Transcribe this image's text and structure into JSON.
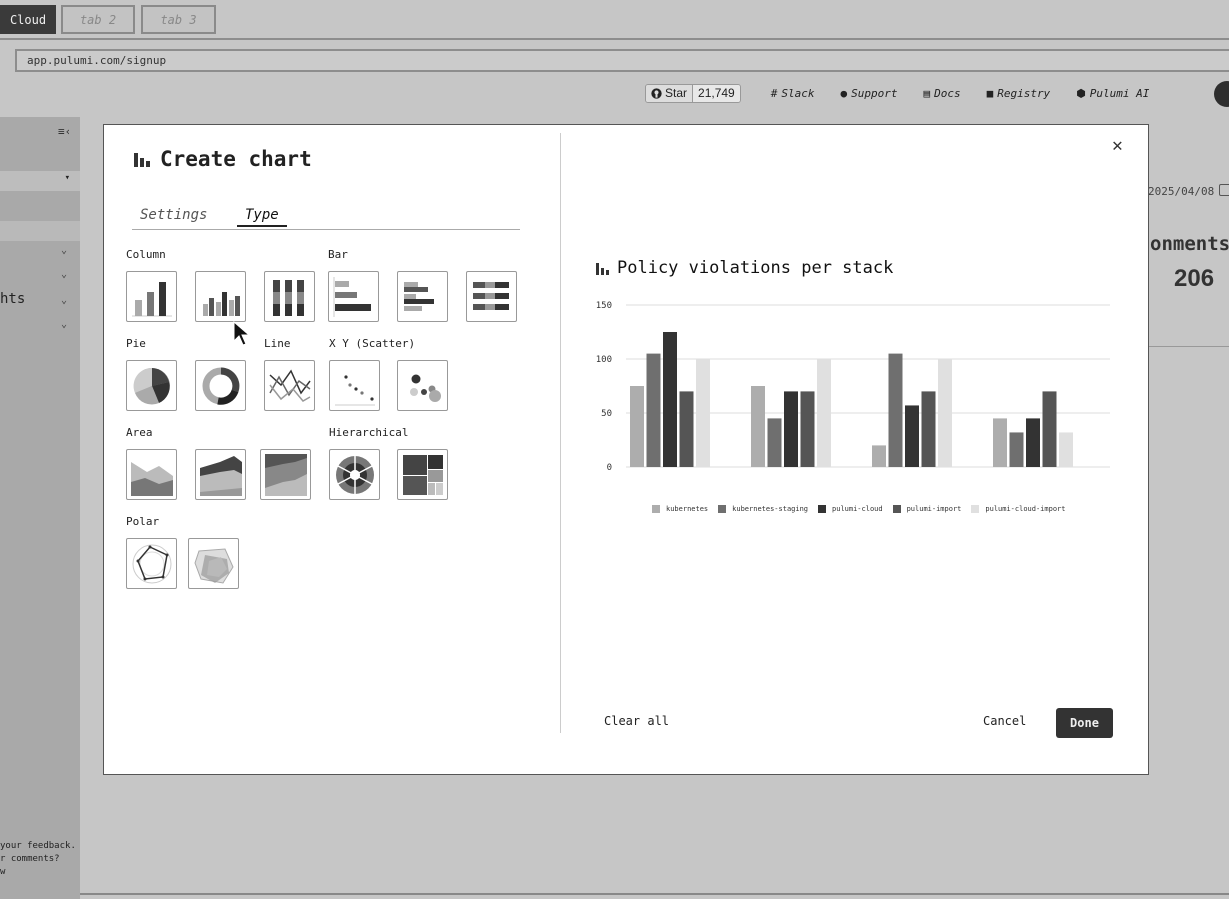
{
  "browser": {
    "tabs": [
      {
        "label": "Cloud",
        "active": true
      },
      {
        "label": "tab 2",
        "active": false
      },
      {
        "label": "tab 3",
        "active": false
      }
    ],
    "url": "app.pulumi.com/signup"
  },
  "header": {
    "github": {
      "star_label": "Star",
      "count": "21,749"
    },
    "links": [
      {
        "label": "Slack",
        "icon": "slack-icon"
      },
      {
        "label": "Support",
        "icon": "help-icon"
      },
      {
        "label": "Docs",
        "icon": "docs-icon"
      },
      {
        "label": "Registry",
        "icon": "registry-icon"
      },
      {
        "label": "Pulumi AI",
        "icon": "robot-icon"
      }
    ]
  },
  "sidebar": {
    "partial_text": "hts",
    "feedback_lines": [
      "your feedback.",
      "r comments?",
      "w"
    ]
  },
  "background": {
    "date": "2025/04/08",
    "comments_label": "onments",
    "comments_count": "206"
  },
  "modal": {
    "title": "Create chart",
    "tabs": {
      "settings": "Settings",
      "type": "Type",
      "active": "Type"
    },
    "categories": {
      "column": "Column",
      "bar": "Bar",
      "pie": "Pie",
      "line": "Line",
      "scatter": "X Y (Scatter)",
      "area": "Area",
      "hierarchical": "Hierarchical",
      "polar": "Polar"
    },
    "selected_type": "column-clustered",
    "buttons": {
      "clear_all": "Clear all",
      "cancel": "Cancel",
      "done": "Done"
    }
  },
  "colors": {
    "kubernetes": "#adadad",
    "kubernetes-staging": "#6f6f6f",
    "pulumi-cloud": "#333333",
    "pulumi-import": "#555555",
    "pulumi-cloud-import": "#e0e0e0"
  },
  "chart_data": {
    "type": "bar",
    "title": "Policy violations per stack",
    "categories": [
      "",
      "",
      "",
      ""
    ],
    "ylim": [
      0,
      150
    ],
    "yticks": [
      0,
      50,
      100,
      150
    ],
    "grid": true,
    "legend_position": "bottom",
    "series": [
      {
        "name": "kubernetes",
        "values": [
          75,
          75,
          20,
          45
        ]
      },
      {
        "name": "kubernetes-staging",
        "values": [
          105,
          45,
          105,
          32
        ]
      },
      {
        "name": "pulumi-cloud",
        "values": [
          125,
          70,
          57,
          45
        ]
      },
      {
        "name": "pulumi-import",
        "values": [
          70,
          70,
          70,
          70
        ]
      },
      {
        "name": "pulumi-cloud-import",
        "values": [
          100,
          100,
          100,
          32
        ]
      }
    ]
  }
}
